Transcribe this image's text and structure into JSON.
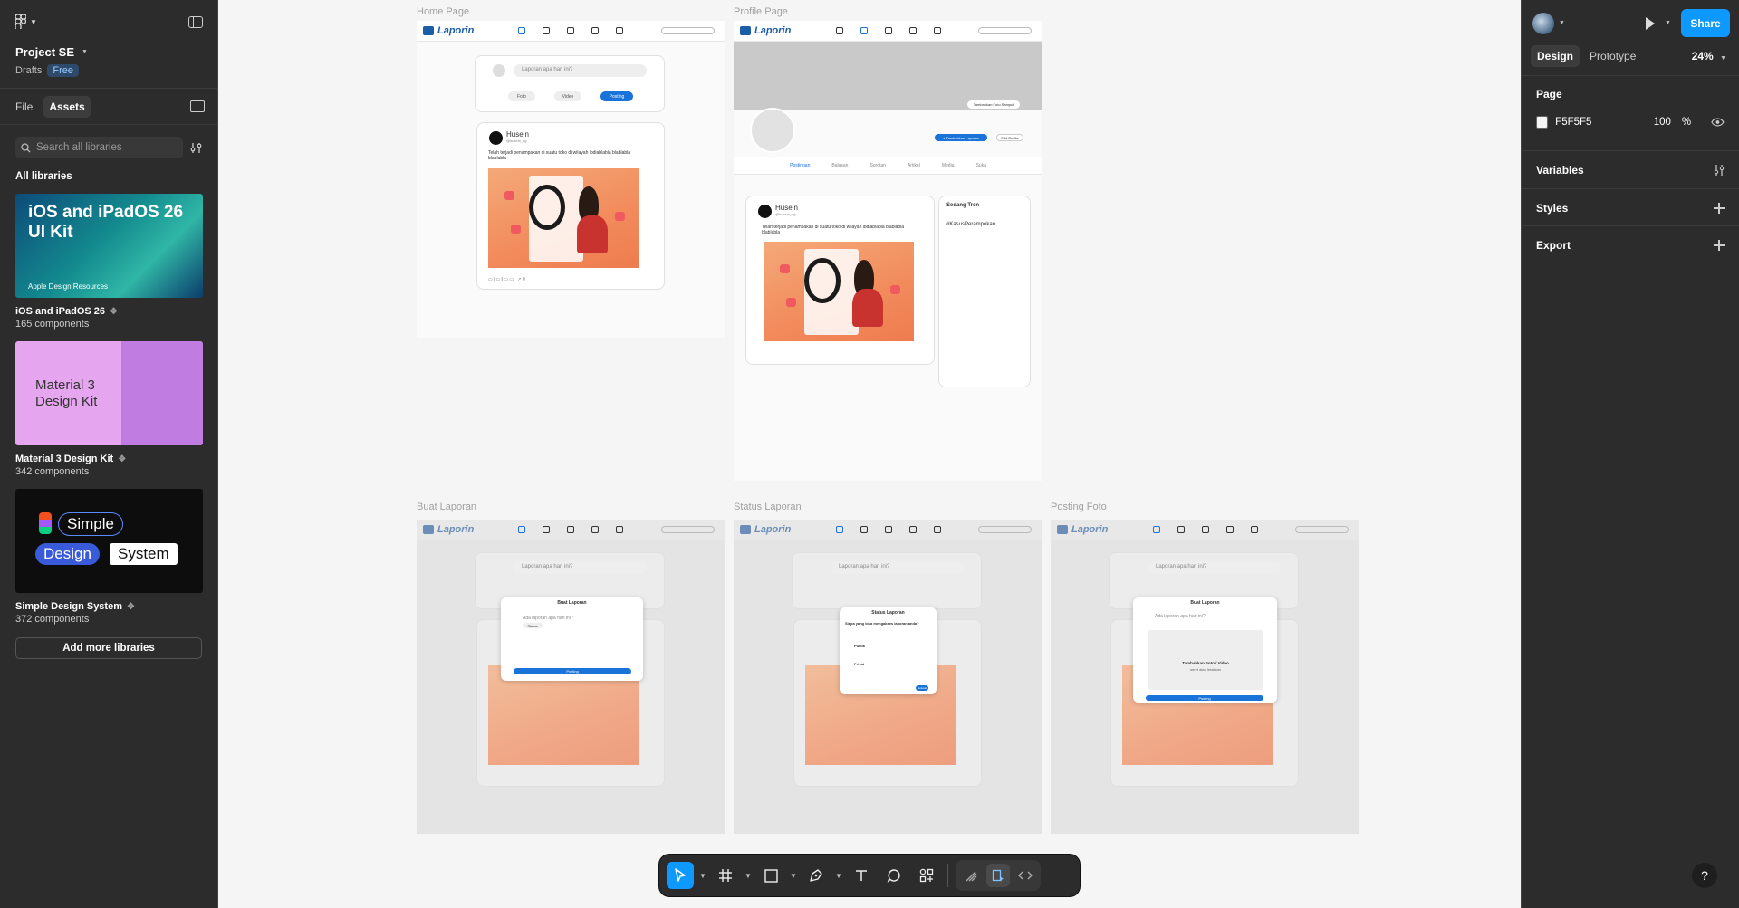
{
  "app": {
    "project_title": "Project SE",
    "drafts_label": "Drafts",
    "plan_badge": "Free"
  },
  "left_panel": {
    "tabs": [
      {
        "label": "File",
        "active": false
      },
      {
        "label": "Assets",
        "active": true
      }
    ],
    "search_placeholder": "Search all libraries",
    "libraries_heading": "All libraries",
    "libraries": [
      {
        "name": "iOS and iPadOS 26",
        "components": "165 components",
        "thumb_title": "iOS and iPadOS 26 UI Kit",
        "thumb_sub": "Apple Design Resources"
      },
      {
        "name": "Material 3 Design Kit",
        "components": "342 components",
        "thumb_title": "Material 3 Design Kit"
      },
      {
        "name": "Simple Design System",
        "components": "372 components",
        "thumb_words": [
          "Simple",
          "Design",
          "System"
        ]
      }
    ],
    "add_libraries_label": "Add more libraries"
  },
  "right_panel": {
    "share_label": "Share",
    "tabs": [
      {
        "label": "Design",
        "active": true
      },
      {
        "label": "Prototype",
        "active": false
      }
    ],
    "zoom": "24%",
    "page_heading": "Page",
    "page_color_hex": "F5F5F5",
    "page_opacity": "100",
    "percent_sign": "%",
    "sections": [
      "Variables",
      "Styles",
      "Export"
    ],
    "help_label": "?"
  },
  "canvas": {
    "frames": [
      {
        "label": "Home Page"
      },
      {
        "label": "Profile Page"
      },
      {
        "label": "Buat Laporan"
      },
      {
        "label": "Status Laporan"
      },
      {
        "label": "Posting Foto"
      }
    ],
    "mock": {
      "logo": "Laporin",
      "input_placeholder": "Laporan apa hari ini?",
      "foto": "Foto",
      "video": "Video",
      "posting": "Posting",
      "user": "Husein",
      "handle": "@husein_ug",
      "post_text": "Telah terjadi penampakan di suatu toko di wilayah lbdiablabla blablabla blablabla",
      "cover_btn": "Tambahkan Foto Sampul",
      "add_report": "+ Tambahkan Laporan",
      "edit_profile": "Edit Profile",
      "profile_tabs": [
        "Postingan",
        "Balasan",
        "Sorotan",
        "Artikel",
        "Media",
        "Suka"
      ],
      "trending_title": "Sedang Tren",
      "trending_tag": "#KasusPerampokan",
      "modal_title": "Buat Laporan",
      "modal_placeholder": "Ada laporan apa hari ini?",
      "status_title": "Status Laporan",
      "status_question": "Siapa yang bisa mengakses laporan anda?",
      "status_public": "Publik",
      "status_private": "Privat",
      "status_done": "Selesai",
      "upload_label": "Tambahkan Foto / Video",
      "upload_sub": "seret atau letakkan",
      "status_chip": "Status"
    }
  },
  "toolbar": {
    "tools": [
      "move-tool",
      "frame-tool",
      "shape-tool",
      "pen-tool",
      "text-tool",
      "comment-tool",
      "actions-tool"
    ],
    "modes": [
      "draw-mode",
      "design-mode",
      "dev-mode"
    ]
  },
  "colors": {
    "accent": "#0d99ff",
    "brand_blue": "#1a5ea8",
    "panel_bg": "#2c2c2c",
    "canvas_bg": "#f5f5f5"
  }
}
